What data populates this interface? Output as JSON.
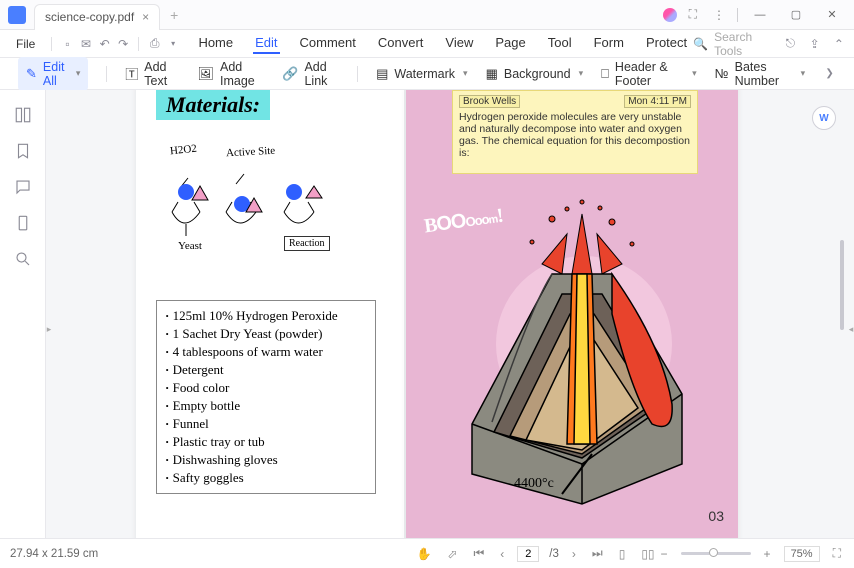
{
  "tab": {
    "title": "science-copy.pdf"
  },
  "menu": {
    "file": "File",
    "tabs": [
      "Home",
      "Edit",
      "Comment",
      "Convert",
      "View",
      "Page",
      "Tool",
      "Form",
      "Protect"
    ],
    "active": 1,
    "search_placeholder": "Search Tools"
  },
  "toolbar": {
    "edit_all": "Edit All",
    "add_text": "Add Text",
    "add_image": "Add Image",
    "add_link": "Add Link",
    "watermark": "Watermark",
    "background": "Background",
    "header_footer": "Header & Footer",
    "bates_number": "Bates Number"
  },
  "document": {
    "materials_title": "Materials:",
    "diagram": {
      "h2o2": "H2O2",
      "active_site": "Active Site",
      "yeast": "Yeast",
      "reaction": "Reaction"
    },
    "materials_list": [
      "125ml 10% Hydrogen Peroxide",
      "1 Sachet Dry Yeast (powder)",
      "4 tablespoons of warm water",
      "Detergent",
      "Food color",
      "Empty bottle",
      "Funnel",
      "Plastic tray or tub",
      "Dishwashing gloves",
      "Safty goggles"
    ],
    "sticky": {
      "author": "Brook Wells",
      "time": "Mon 4:11 PM",
      "text": "Hydrogen peroxide molecules are very unstable and naturally decompose into water and oxygen gas. The chemical equation for this decompostion is:"
    },
    "boom": "BOOooom!",
    "temperature": "4400°c",
    "page_number": "03"
  },
  "status": {
    "dimensions": "27.94 x 21.59 cm",
    "current_page": "2",
    "total_pages": "/3",
    "zoom": "75%"
  }
}
